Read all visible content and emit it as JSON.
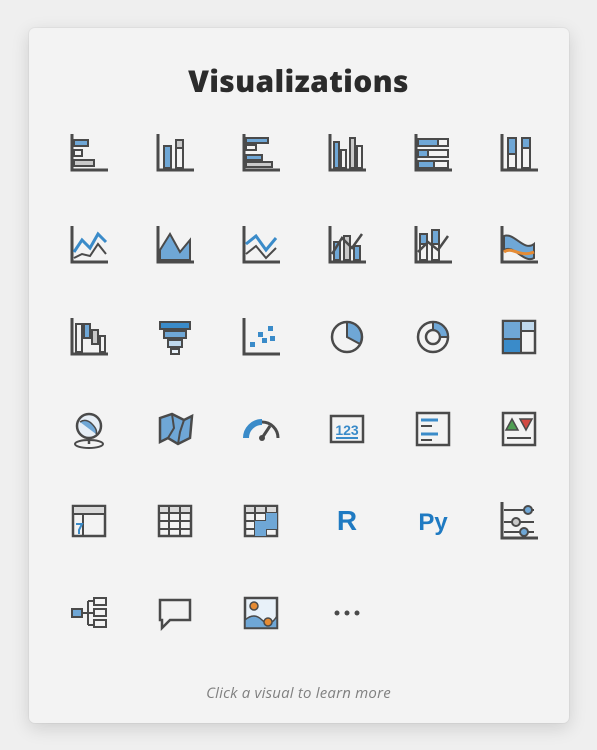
{
  "panel": {
    "title": "Visualizations",
    "hint": "Click a visual to learn more"
  },
  "icons": [
    {
      "name": "stacked-bar-chart-icon"
    },
    {
      "name": "stacked-column-chart-icon"
    },
    {
      "name": "clustered-bar-chart-icon"
    },
    {
      "name": "clustered-column-chart-icon"
    },
    {
      "name": "hundred-percent-stacked-bar-chart-icon"
    },
    {
      "name": "hundred-percent-stacked-column-chart-icon"
    },
    {
      "name": "line-chart-icon"
    },
    {
      "name": "area-chart-icon"
    },
    {
      "name": "stacked-area-chart-icon"
    },
    {
      "name": "line-clustered-column-combo-icon"
    },
    {
      "name": "line-stacked-column-combo-icon"
    },
    {
      "name": "ribbon-chart-icon"
    },
    {
      "name": "waterfall-chart-icon"
    },
    {
      "name": "funnel-chart-icon"
    },
    {
      "name": "scatter-chart-icon"
    },
    {
      "name": "pie-chart-icon"
    },
    {
      "name": "donut-chart-icon"
    },
    {
      "name": "treemap-icon"
    },
    {
      "name": "map-icon"
    },
    {
      "name": "filled-map-icon"
    },
    {
      "name": "gauge-icon"
    },
    {
      "name": "card-icon"
    },
    {
      "name": "multi-row-card-icon"
    },
    {
      "name": "kpi-icon"
    },
    {
      "name": "slicer-icon"
    },
    {
      "name": "table-icon"
    },
    {
      "name": "matrix-icon"
    },
    {
      "name": "r-script-visual-icon",
      "label": "R"
    },
    {
      "name": "python-visual-icon",
      "label": "Py"
    },
    {
      "name": "key-influencers-icon"
    },
    {
      "name": "decomposition-tree-icon"
    },
    {
      "name": "qa-icon"
    },
    {
      "name": "arcgis-map-icon"
    },
    {
      "name": "more-visuals-icon"
    }
  ],
  "colors": {
    "stroke": "#4a4a4a",
    "blue": "#6fa7d6",
    "blueDk": "#3a8bc9",
    "orange": "#e58b34",
    "accent": "#1f7ac2"
  }
}
